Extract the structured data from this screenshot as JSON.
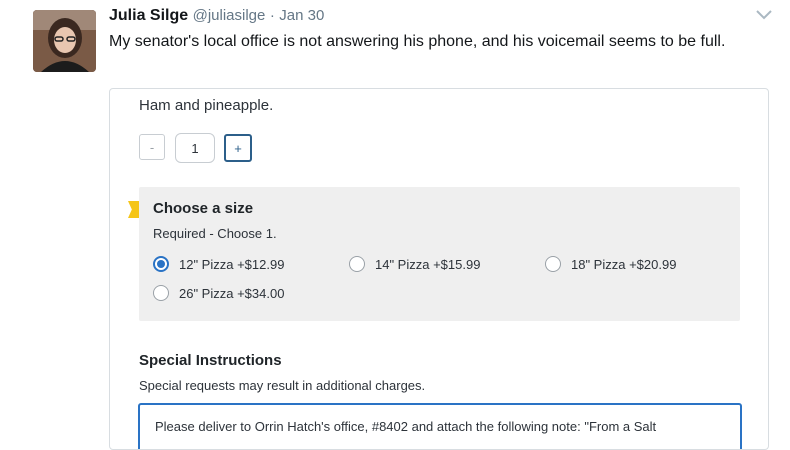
{
  "tweet": {
    "name": "Julia Silge",
    "handle": "@juliasilge",
    "separator": "·",
    "date": "Jan 30",
    "text": "My senator's local office is not answering his phone, and his voicemail seems to be full."
  },
  "order_card": {
    "item_description": "Ham and pineapple.",
    "quantity": {
      "minus_label": "-",
      "value": "1",
      "plus_label": "+"
    },
    "size_section": {
      "title": "Choose a size",
      "subtitle": "Required - Choose 1.",
      "selected_index": 0,
      "options": [
        {
          "label": "12\" Pizza +$12.99"
        },
        {
          "label": "14\" Pizza +$15.99"
        },
        {
          "label": "18\" Pizza +$20.99"
        },
        {
          "label": "26\" Pizza +$34.00"
        }
      ]
    },
    "special_instructions": {
      "title": "Special Instructions",
      "subtitle": "Special requests may result in additional charges.",
      "value": "Please deliver to Orrin Hatch's office, #8402 and attach the following note: \"From a Salt"
    }
  },
  "colors": {
    "accent": "#2a73c5",
    "required_flag": "#f5c518",
    "section_bg": "#efefef"
  },
  "icons": {
    "menu": "chevron-down-icon"
  }
}
